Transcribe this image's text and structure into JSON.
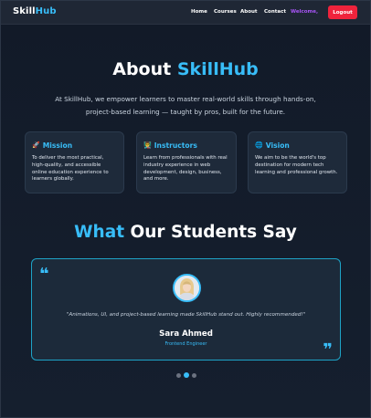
{
  "navbar": {
    "logo_part1": "Skill",
    "logo_part2": "Hub",
    "links": [
      "Home",
      "Courses",
      "About",
      "Contact"
    ],
    "welcome": "Welcome,",
    "logout_label": "Logout"
  },
  "about": {
    "title_part1": "About",
    "title_part2": "SkillHub",
    "description": "At SkillHub, we empower learners to master real-world skills through hands-on, project-based learning — taught by pros, built for the future.",
    "cards": [
      {
        "icon": "🚀",
        "icon_name": "rocket-icon",
        "title": "Mission",
        "text": "To deliver the most practical, high-quality, and accessible online education experience to learners globally."
      },
      {
        "icon": "👨‍🏫",
        "icon_name": "teacher-icon",
        "title": "Instructors",
        "text": "Learn from professionals with real industry experience in web development, design, business, and more."
      },
      {
        "icon": "🌐",
        "icon_name": "globe-icon",
        "title": "Vision",
        "text": "We aim to be the world's top destination for modern tech learning and professional growth."
      }
    ]
  },
  "testimonials": {
    "title_part1": "What",
    "title_part2": "Our Students Say",
    "quote_open": "❝",
    "quote_close": "❞",
    "quote": "\"Animations, UI, and project-based learning made SkillHub stand out. Highly recommended!\"",
    "name": "Sara Ahmed",
    "role": "Frontend Engineer",
    "carousel": {
      "count": 3,
      "active_index": 1
    }
  },
  "colors": {
    "accent": "#38bdf8",
    "welcome": "#a855f7",
    "logout": "#ef233c",
    "background": "#121b2a",
    "card": "#1e2a3a"
  }
}
